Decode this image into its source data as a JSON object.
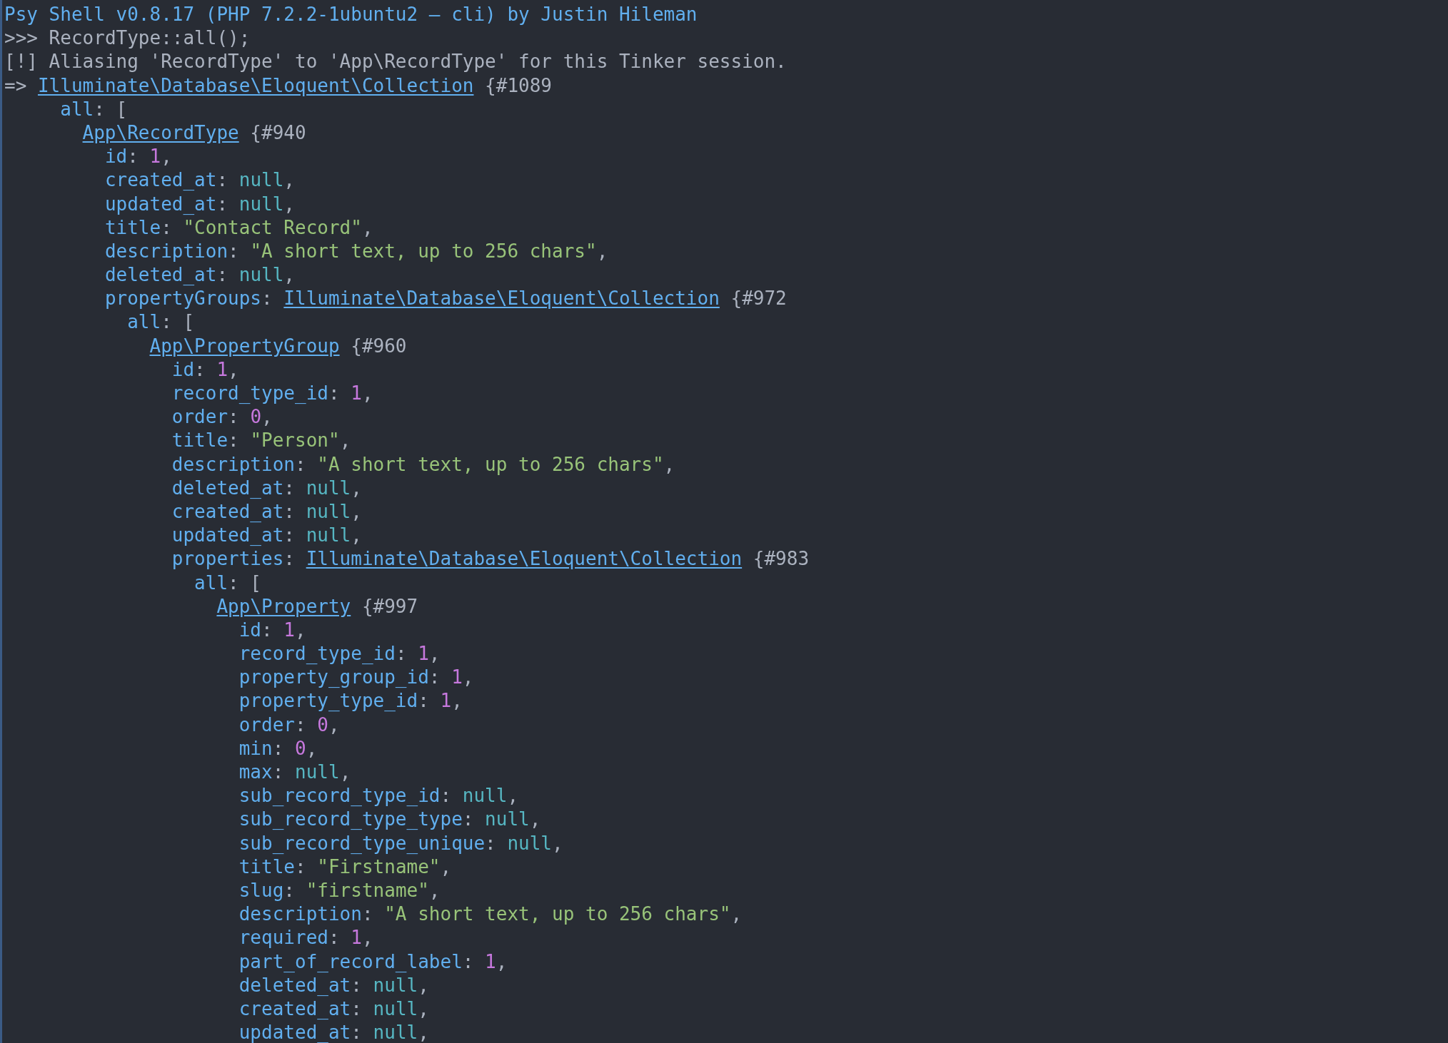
{
  "terminal": {
    "lines": [
      {
        "parts": [
          {
            "kind": "banner",
            "text": "Psy Shell v0.8.17 (PHP 7.2.2-1ubuntu2 — cli) by Justin Hileman"
          }
        ]
      },
      {
        "parts": [
          {
            "kind": "plain",
            "text": ">>> RecordType::all();"
          }
        ]
      },
      {
        "parts": [
          {
            "kind": "plain",
            "text": "[!] Aliasing 'RecordType' to 'App\\RecordType' for this Tinker session."
          }
        ]
      },
      {
        "parts": [
          {
            "kind": "plain",
            "text": "=> "
          },
          {
            "kind": "link",
            "text": "Illuminate\\Database\\Eloquent\\Collection"
          },
          {
            "kind": "objid",
            "text": " {#1089"
          }
        ],
        "children": [
          {
            "parts": [
              {
                "kind": "key",
                "text": "all"
              },
              {
                "kind": "punct",
                "text": ": ["
              }
            ],
            "children": [
              {
                "parts": [
                  {
                    "kind": "link",
                    "text": "App\\RecordType"
                  },
                  {
                    "kind": "objid",
                    "text": " {#940"
                  }
                ],
                "children": [
                  {
                    "parts": [
                      {
                        "kind": "key",
                        "text": "id"
                      },
                      {
                        "kind": "punct",
                        "text": ": "
                      },
                      {
                        "kind": "number",
                        "text": "1"
                      },
                      {
                        "kind": "punct",
                        "text": ","
                      }
                    ]
                  },
                  {
                    "parts": [
                      {
                        "kind": "key",
                        "text": "created_at"
                      },
                      {
                        "kind": "punct",
                        "text": ": "
                      },
                      {
                        "kind": "null",
                        "text": "null"
                      },
                      {
                        "kind": "punct",
                        "text": ","
                      }
                    ]
                  },
                  {
                    "parts": [
                      {
                        "kind": "key",
                        "text": "updated_at"
                      },
                      {
                        "kind": "punct",
                        "text": ": "
                      },
                      {
                        "kind": "null",
                        "text": "null"
                      },
                      {
                        "kind": "punct",
                        "text": ","
                      }
                    ]
                  },
                  {
                    "parts": [
                      {
                        "kind": "key",
                        "text": "title"
                      },
                      {
                        "kind": "punct",
                        "text": ": "
                      },
                      {
                        "kind": "string",
                        "text": "\"Contact Record\""
                      },
                      {
                        "kind": "punct",
                        "text": ","
                      }
                    ]
                  },
                  {
                    "parts": [
                      {
                        "kind": "key",
                        "text": "description"
                      },
                      {
                        "kind": "punct",
                        "text": ": "
                      },
                      {
                        "kind": "string",
                        "text": "\"A short text, up to 256 chars\""
                      },
                      {
                        "kind": "punct",
                        "text": ","
                      }
                    ]
                  },
                  {
                    "parts": [
                      {
                        "kind": "key",
                        "text": "deleted_at"
                      },
                      {
                        "kind": "punct",
                        "text": ": "
                      },
                      {
                        "kind": "null",
                        "text": "null"
                      },
                      {
                        "kind": "punct",
                        "text": ","
                      }
                    ]
                  },
                  {
                    "parts": [
                      {
                        "kind": "key",
                        "text": "propertyGroups"
                      },
                      {
                        "kind": "punct",
                        "text": ": "
                      },
                      {
                        "kind": "link",
                        "text": "Illuminate\\Database\\Eloquent\\Collection"
                      },
                      {
                        "kind": "objid",
                        "text": " {#972"
                      }
                    ],
                    "children": [
                      {
                        "parts": [
                          {
                            "kind": "key",
                            "text": "all"
                          },
                          {
                            "kind": "punct",
                            "text": ": ["
                          }
                        ],
                        "children": [
                          {
                            "parts": [
                              {
                                "kind": "link",
                                "text": "App\\PropertyGroup"
                              },
                              {
                                "kind": "objid",
                                "text": " {#960"
                              }
                            ],
                            "children": [
                              {
                                "parts": [
                                  {
                                    "kind": "key",
                                    "text": "id"
                                  },
                                  {
                                    "kind": "punct",
                                    "text": ": "
                                  },
                                  {
                                    "kind": "number",
                                    "text": "1"
                                  },
                                  {
                                    "kind": "punct",
                                    "text": ","
                                  }
                                ]
                              },
                              {
                                "parts": [
                                  {
                                    "kind": "key",
                                    "text": "record_type_id"
                                  },
                                  {
                                    "kind": "punct",
                                    "text": ": "
                                  },
                                  {
                                    "kind": "number",
                                    "text": "1"
                                  },
                                  {
                                    "kind": "punct",
                                    "text": ","
                                  }
                                ]
                              },
                              {
                                "parts": [
                                  {
                                    "kind": "key",
                                    "text": "order"
                                  },
                                  {
                                    "kind": "punct",
                                    "text": ": "
                                  },
                                  {
                                    "kind": "number",
                                    "text": "0"
                                  },
                                  {
                                    "kind": "punct",
                                    "text": ","
                                  }
                                ]
                              },
                              {
                                "parts": [
                                  {
                                    "kind": "key",
                                    "text": "title"
                                  },
                                  {
                                    "kind": "punct",
                                    "text": ": "
                                  },
                                  {
                                    "kind": "string",
                                    "text": "\"Person\""
                                  },
                                  {
                                    "kind": "punct",
                                    "text": ","
                                  }
                                ]
                              },
                              {
                                "parts": [
                                  {
                                    "kind": "key",
                                    "text": "description"
                                  },
                                  {
                                    "kind": "punct",
                                    "text": ": "
                                  },
                                  {
                                    "kind": "string",
                                    "text": "\"A short text, up to 256 chars\""
                                  },
                                  {
                                    "kind": "punct",
                                    "text": ","
                                  }
                                ]
                              },
                              {
                                "parts": [
                                  {
                                    "kind": "key",
                                    "text": "deleted_at"
                                  },
                                  {
                                    "kind": "punct",
                                    "text": ": "
                                  },
                                  {
                                    "kind": "null",
                                    "text": "null"
                                  },
                                  {
                                    "kind": "punct",
                                    "text": ","
                                  }
                                ]
                              },
                              {
                                "parts": [
                                  {
                                    "kind": "key",
                                    "text": "created_at"
                                  },
                                  {
                                    "kind": "punct",
                                    "text": ": "
                                  },
                                  {
                                    "kind": "null",
                                    "text": "null"
                                  },
                                  {
                                    "kind": "punct",
                                    "text": ","
                                  }
                                ]
                              },
                              {
                                "parts": [
                                  {
                                    "kind": "key",
                                    "text": "updated_at"
                                  },
                                  {
                                    "kind": "punct",
                                    "text": ": "
                                  },
                                  {
                                    "kind": "null",
                                    "text": "null"
                                  },
                                  {
                                    "kind": "punct",
                                    "text": ","
                                  }
                                ]
                              },
                              {
                                "parts": [
                                  {
                                    "kind": "key",
                                    "text": "properties"
                                  },
                                  {
                                    "kind": "punct",
                                    "text": ": "
                                  },
                                  {
                                    "kind": "link",
                                    "text": "Illuminate\\Database\\Eloquent\\Collection"
                                  },
                                  {
                                    "kind": "objid",
                                    "text": " {#983"
                                  }
                                ],
                                "children": [
                                  {
                                    "parts": [
                                      {
                                        "kind": "key",
                                        "text": "all"
                                      },
                                      {
                                        "kind": "punct",
                                        "text": ": ["
                                      }
                                    ],
                                    "children": [
                                      {
                                        "parts": [
                                          {
                                            "kind": "link",
                                            "text": "App\\Property"
                                          },
                                          {
                                            "kind": "objid",
                                            "text": " {#997"
                                          }
                                        ],
                                        "children": [
                                          {
                                            "parts": [
                                              {
                                                "kind": "key",
                                                "text": "id"
                                              },
                                              {
                                                "kind": "punct",
                                                "text": ": "
                                              },
                                              {
                                                "kind": "number",
                                                "text": "1"
                                              },
                                              {
                                                "kind": "punct",
                                                "text": ","
                                              }
                                            ]
                                          },
                                          {
                                            "parts": [
                                              {
                                                "kind": "key",
                                                "text": "record_type_id"
                                              },
                                              {
                                                "kind": "punct",
                                                "text": ": "
                                              },
                                              {
                                                "kind": "number",
                                                "text": "1"
                                              },
                                              {
                                                "kind": "punct",
                                                "text": ","
                                              }
                                            ]
                                          },
                                          {
                                            "parts": [
                                              {
                                                "kind": "key",
                                                "text": "property_group_id"
                                              },
                                              {
                                                "kind": "punct",
                                                "text": ": "
                                              },
                                              {
                                                "kind": "number",
                                                "text": "1"
                                              },
                                              {
                                                "kind": "punct",
                                                "text": ","
                                              }
                                            ]
                                          },
                                          {
                                            "parts": [
                                              {
                                                "kind": "key",
                                                "text": "property_type_id"
                                              },
                                              {
                                                "kind": "punct",
                                                "text": ": "
                                              },
                                              {
                                                "kind": "number",
                                                "text": "1"
                                              },
                                              {
                                                "kind": "punct",
                                                "text": ","
                                              }
                                            ]
                                          },
                                          {
                                            "parts": [
                                              {
                                                "kind": "key",
                                                "text": "order"
                                              },
                                              {
                                                "kind": "punct",
                                                "text": ": "
                                              },
                                              {
                                                "kind": "number",
                                                "text": "0"
                                              },
                                              {
                                                "kind": "punct",
                                                "text": ","
                                              }
                                            ]
                                          },
                                          {
                                            "parts": [
                                              {
                                                "kind": "key",
                                                "text": "min"
                                              },
                                              {
                                                "kind": "punct",
                                                "text": ": "
                                              },
                                              {
                                                "kind": "number",
                                                "text": "0"
                                              },
                                              {
                                                "kind": "punct",
                                                "text": ","
                                              }
                                            ]
                                          },
                                          {
                                            "parts": [
                                              {
                                                "kind": "key",
                                                "text": "max"
                                              },
                                              {
                                                "kind": "punct",
                                                "text": ": "
                                              },
                                              {
                                                "kind": "null",
                                                "text": "null"
                                              },
                                              {
                                                "kind": "punct",
                                                "text": ","
                                              }
                                            ]
                                          },
                                          {
                                            "parts": [
                                              {
                                                "kind": "key",
                                                "text": "sub_record_type_id"
                                              },
                                              {
                                                "kind": "punct",
                                                "text": ": "
                                              },
                                              {
                                                "kind": "null",
                                                "text": "null"
                                              },
                                              {
                                                "kind": "punct",
                                                "text": ","
                                              }
                                            ]
                                          },
                                          {
                                            "parts": [
                                              {
                                                "kind": "key",
                                                "text": "sub_record_type_type"
                                              },
                                              {
                                                "kind": "punct",
                                                "text": ": "
                                              },
                                              {
                                                "kind": "null",
                                                "text": "null"
                                              },
                                              {
                                                "kind": "punct",
                                                "text": ","
                                              }
                                            ]
                                          },
                                          {
                                            "parts": [
                                              {
                                                "kind": "key",
                                                "text": "sub_record_type_unique"
                                              },
                                              {
                                                "kind": "punct",
                                                "text": ": "
                                              },
                                              {
                                                "kind": "null",
                                                "text": "null"
                                              },
                                              {
                                                "kind": "punct",
                                                "text": ","
                                              }
                                            ]
                                          },
                                          {
                                            "parts": [
                                              {
                                                "kind": "key",
                                                "text": "title"
                                              },
                                              {
                                                "kind": "punct",
                                                "text": ": "
                                              },
                                              {
                                                "kind": "string",
                                                "text": "\"Firstname\""
                                              },
                                              {
                                                "kind": "punct",
                                                "text": ","
                                              }
                                            ]
                                          },
                                          {
                                            "parts": [
                                              {
                                                "kind": "key",
                                                "text": "slug"
                                              },
                                              {
                                                "kind": "punct",
                                                "text": ": "
                                              },
                                              {
                                                "kind": "string",
                                                "text": "\"firstname\""
                                              },
                                              {
                                                "kind": "punct",
                                                "text": ","
                                              }
                                            ]
                                          },
                                          {
                                            "parts": [
                                              {
                                                "kind": "key",
                                                "text": "description"
                                              },
                                              {
                                                "kind": "punct",
                                                "text": ": "
                                              },
                                              {
                                                "kind": "string",
                                                "text": "\"A short text, up to 256 chars\""
                                              },
                                              {
                                                "kind": "punct",
                                                "text": ","
                                              }
                                            ]
                                          },
                                          {
                                            "parts": [
                                              {
                                                "kind": "key",
                                                "text": "required"
                                              },
                                              {
                                                "kind": "punct",
                                                "text": ": "
                                              },
                                              {
                                                "kind": "number",
                                                "text": "1"
                                              },
                                              {
                                                "kind": "punct",
                                                "text": ","
                                              }
                                            ]
                                          },
                                          {
                                            "parts": [
                                              {
                                                "kind": "key",
                                                "text": "part_of_record_label"
                                              },
                                              {
                                                "kind": "punct",
                                                "text": ": "
                                              },
                                              {
                                                "kind": "number",
                                                "text": "1"
                                              },
                                              {
                                                "kind": "punct",
                                                "text": ","
                                              }
                                            ]
                                          },
                                          {
                                            "parts": [
                                              {
                                                "kind": "key",
                                                "text": "deleted_at"
                                              },
                                              {
                                                "kind": "punct",
                                                "text": ": "
                                              },
                                              {
                                                "kind": "null",
                                                "text": "null"
                                              },
                                              {
                                                "kind": "punct",
                                                "text": ","
                                              }
                                            ]
                                          },
                                          {
                                            "parts": [
                                              {
                                                "kind": "key",
                                                "text": "created_at"
                                              },
                                              {
                                                "kind": "punct",
                                                "text": ": "
                                              },
                                              {
                                                "kind": "null",
                                                "text": "null"
                                              },
                                              {
                                                "kind": "punct",
                                                "text": ","
                                              }
                                            ]
                                          },
                                          {
                                            "parts": [
                                              {
                                                "kind": "key",
                                                "text": "updated_at"
                                              },
                                              {
                                                "kind": "punct",
                                                "text": ": "
                                              },
                                              {
                                                "kind": "null",
                                                "text": "null"
                                              },
                                              {
                                                "kind": "punct",
                                                "text": ","
                                              }
                                            ]
                                          }
                                        ]
                                      }
                                    ]
                                  }
                                ]
                              }
                            ]
                          }
                        ]
                      }
                    ]
                  }
                ]
              }
            ]
          }
        ]
      }
    ]
  }
}
